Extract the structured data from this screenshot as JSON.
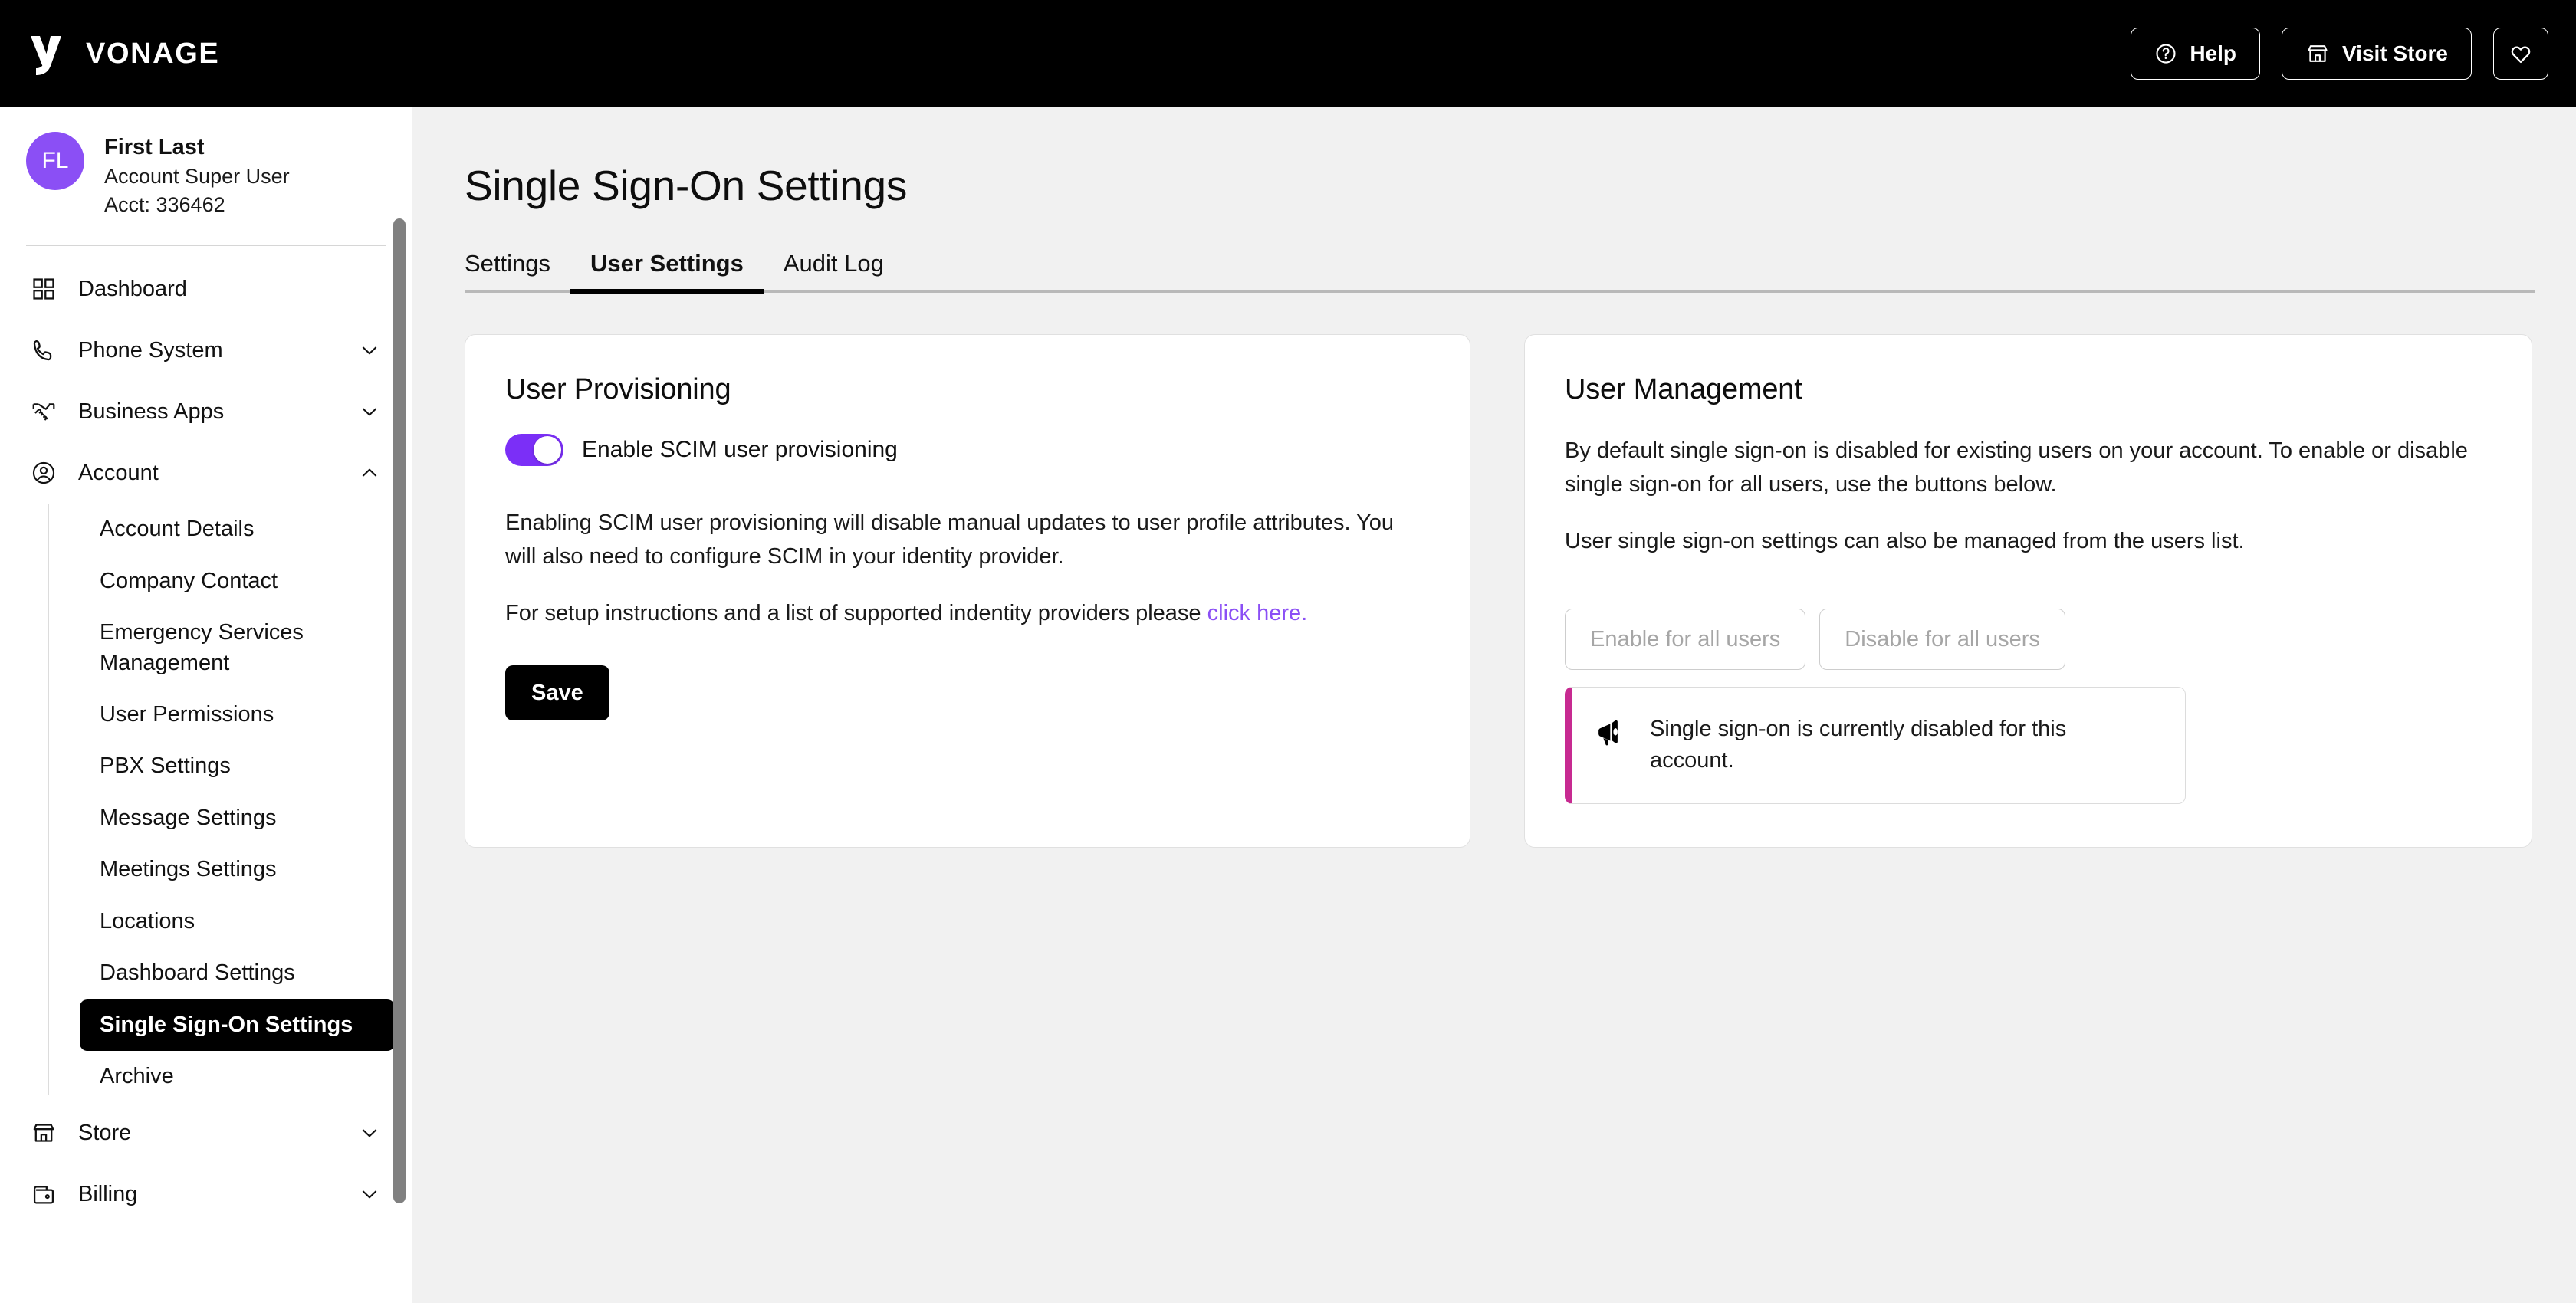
{
  "header": {
    "brand": "VONAGE",
    "logo_icon": "vonage-v-logo",
    "actions": [
      {
        "label": "Help",
        "icon": "question-circle-icon",
        "name": "help-button"
      },
      {
        "label": "Visit Store",
        "icon": "store-icon",
        "name": "visit-store-button"
      },
      {
        "label": "",
        "icon": "heart-icon",
        "name": "favorites-button"
      }
    ]
  },
  "sidebar": {
    "user": {
      "initials": "FL",
      "name": "First Last",
      "role": "Account Super User",
      "account": "Acct: 336462"
    },
    "nav": [
      {
        "label": "Dashboard",
        "icon": "grid-icon",
        "chevron": ""
      },
      {
        "label": "Phone System",
        "icon": "phone-icon",
        "chevron": "chevron-down-icon"
      },
      {
        "label": "Business Apps",
        "icon": "handshake-icon",
        "chevron": "chevron-down-icon"
      },
      {
        "label": "Account",
        "icon": "user-circle-icon",
        "chevron": "chevron-up-icon"
      }
    ],
    "account_subitems": [
      {
        "label": "Account Details",
        "active": false
      },
      {
        "label": "Company Contact",
        "active": false
      },
      {
        "label": "Emergency Services Management",
        "active": false
      },
      {
        "label": "User Permissions",
        "active": false
      },
      {
        "label": "PBX Settings",
        "active": false
      },
      {
        "label": "Message Settings",
        "active": false
      },
      {
        "label": "Meetings Settings",
        "active": false
      },
      {
        "label": "Locations",
        "active": false
      },
      {
        "label": "Dashboard Settings",
        "active": false
      },
      {
        "label": "Single Sign-On Settings",
        "active": true
      },
      {
        "label": "Archive",
        "active": false
      }
    ],
    "nav_bottom": [
      {
        "label": "Store",
        "icon": "store-icon",
        "chevron": "chevron-down-icon"
      },
      {
        "label": "Billing",
        "icon": "wallet-icon",
        "chevron": "chevron-down-icon"
      }
    ]
  },
  "main": {
    "page_title": "Single Sign-On Settings",
    "tabs": [
      {
        "label": "Settings",
        "active": false
      },
      {
        "label": "User Settings",
        "active": true
      },
      {
        "label": "Audit Log",
        "active": false
      }
    ],
    "provisioning": {
      "title": "User Provisioning",
      "toggle_label": "Enable SCIM user provisioning",
      "toggle_state": "on",
      "paragraph1": "Enabling SCIM user provisioning will disable manual updates to user profile attributes. You will also need to configure SCIM in your identity provider.",
      "paragraph2_prefix": "For setup instructions and a list of supported indentity providers please ",
      "paragraph2_link": "click here.",
      "save_label": "Save"
    },
    "management": {
      "title": "User Management",
      "paragraph1": "By default single sign-on is disabled for existing users on your account. To enable or disable single sign-on for all users, use the buttons below.",
      "paragraph2": "User single sign-on settings can also be managed from the users list.",
      "enable_all_label": "Enable for all users",
      "disable_all_label": "Disable for all users",
      "alert_icon": "megaphone-icon",
      "alert_text": "Single sign-on is currently disabled for this account."
    }
  },
  "colors": {
    "brand_black": "#000000",
    "accent_purple": "#7b2ff7",
    "avatar_purple": "#8b4ff5",
    "link_purple": "#8b4ff5",
    "alert_magenta": "#c72a91",
    "page_bg": "#f1f1f1",
    "disabled_text": "#a6a6a6"
  }
}
